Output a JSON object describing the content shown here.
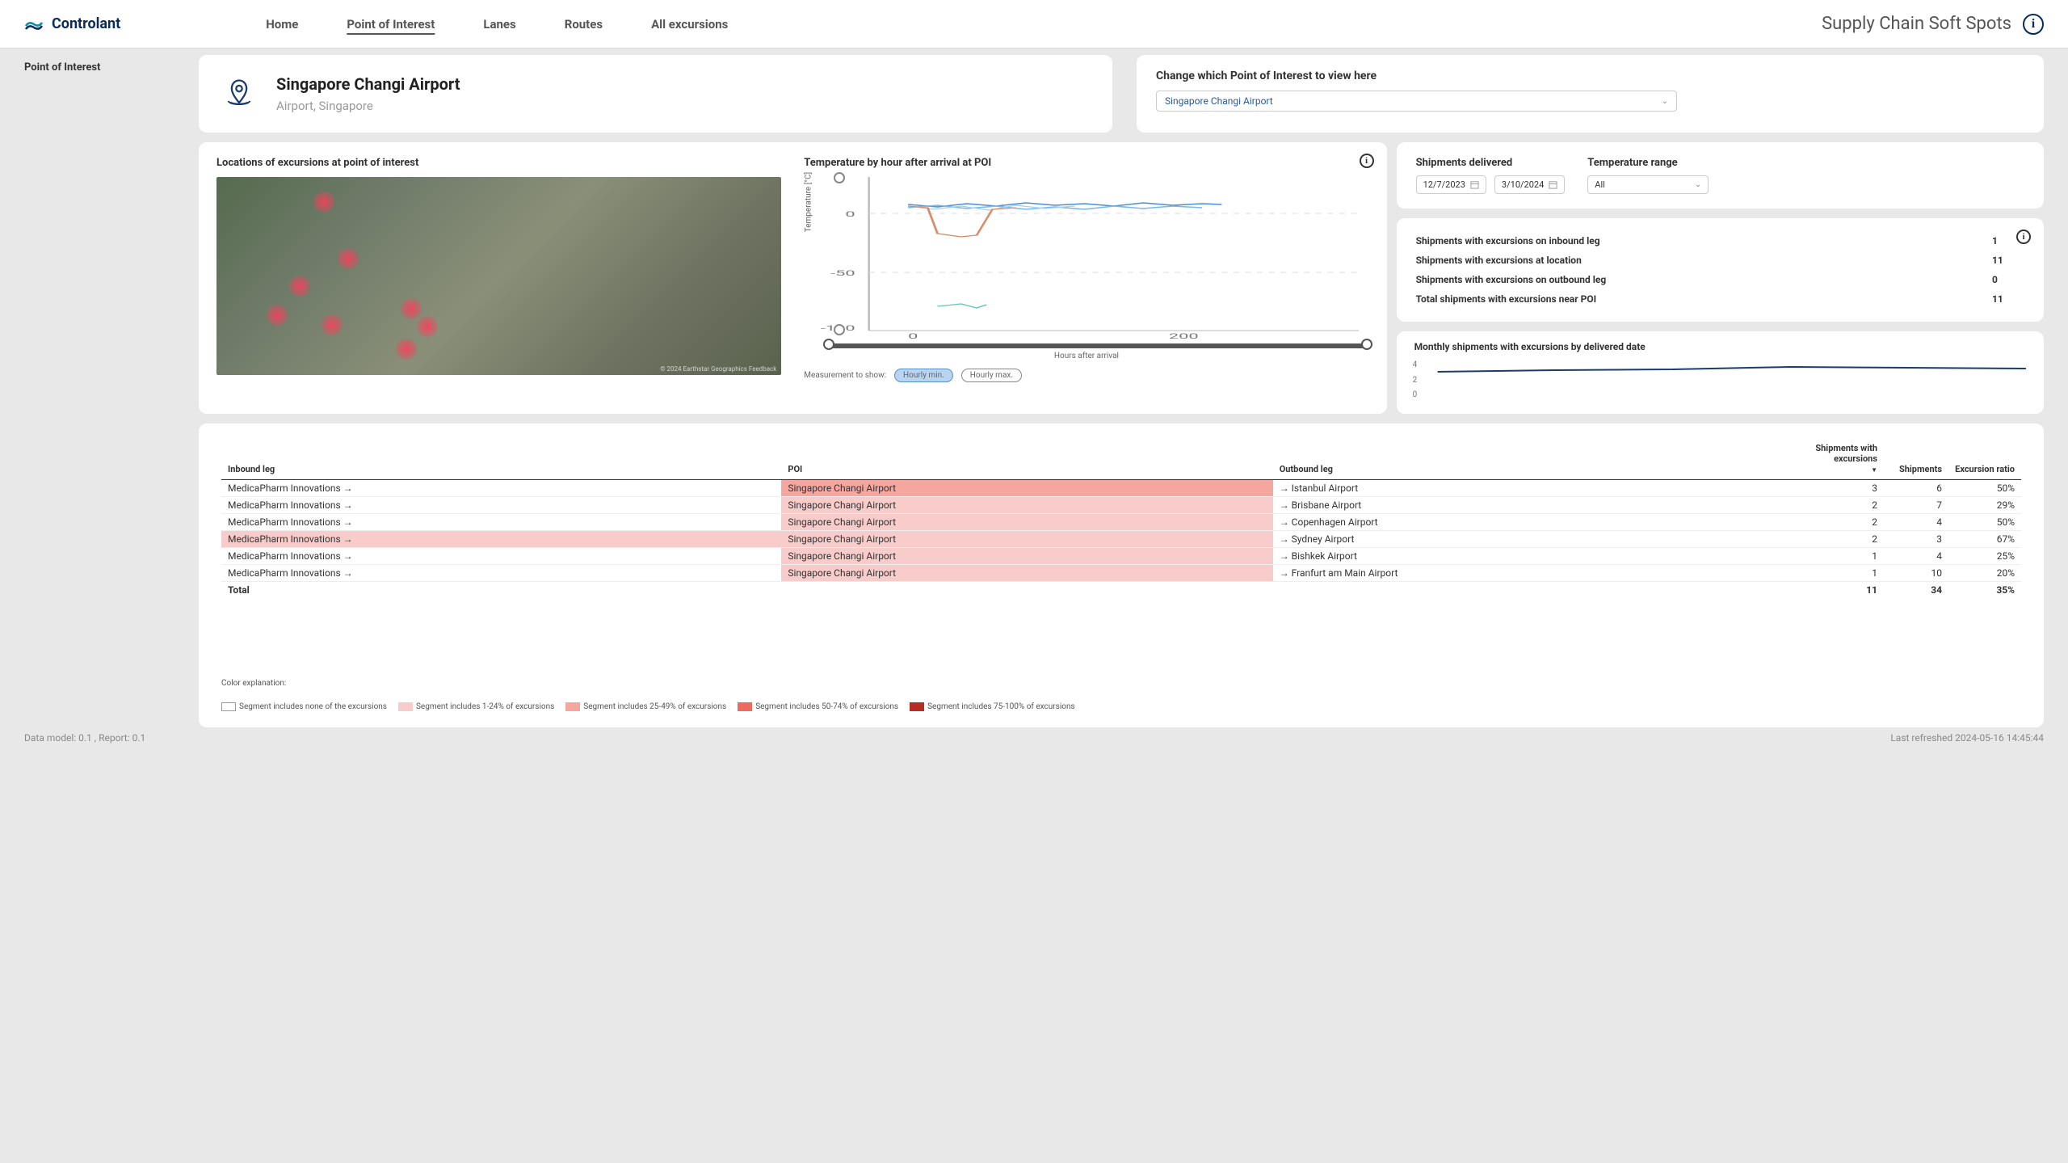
{
  "header": {
    "brand": "Controlant",
    "tabs": [
      "Home",
      "Point of Interest",
      "Lanes",
      "Routes",
      "All excursions"
    ],
    "active_tab": 1,
    "right_title": "Supply Chain Soft Spots"
  },
  "breadcrumb": "Point of Interest",
  "poi": {
    "name": "Singapore Changi Airport",
    "subtitle": "Airport, Singapore",
    "selector_label": "Change which Point of Interest to view here",
    "selector_value": "Singapore Changi Airport"
  },
  "map": {
    "title": "Locations of excursions at point of interest",
    "attribution": "© 2024 Earthstar Geographics  Feedback"
  },
  "temp_chart": {
    "title": "Temperature by hour after arrival at POI",
    "ylabel": "Temperature [°C]",
    "xlabel": "Hours after arrival",
    "measure_label": "Measurement to show:",
    "btn_min": "Hourly min.",
    "btn_max": "Hourly max."
  },
  "filters": {
    "shipments_label": "Shipments delivered",
    "temp_range_label": "Temperature range",
    "date_from": "12/7/2023",
    "date_to": "3/10/2024",
    "temp_range_value": "All"
  },
  "stats": {
    "rows": [
      {
        "label": "Shipments with excursions on inbound leg",
        "value": "1"
      },
      {
        "label": "Shipments with excursions at location",
        "value": "11"
      },
      {
        "label": "Shipments with excursions on outbound leg",
        "value": "0"
      },
      {
        "label": "Total shipments with excursions near POI",
        "value": "11"
      }
    ]
  },
  "monthly": {
    "title": "Monthly shipments with excursions by delivered date",
    "y_ticks": [
      "4",
      "2",
      "0"
    ]
  },
  "table": {
    "columns": [
      "Inbound leg",
      "POI",
      "Outbound leg",
      "Shipments with excursions",
      "Shipments",
      "Excursion ratio"
    ],
    "rows": [
      {
        "inbound": "MedicaPharm Innovations →",
        "in_hi": "none",
        "poi": "Singapore Changi Airport",
        "poi_hi": "50",
        "outbound": "→ Istanbul Airport",
        "out_hi": "none",
        "swe": "3",
        "ship": "6",
        "ratio": "50%"
      },
      {
        "inbound": "MedicaPharm Innovations →",
        "in_hi": "none",
        "poi": "Singapore Changi Airport",
        "poi_hi": "25",
        "outbound": "→ Brisbane Airport",
        "out_hi": "none",
        "swe": "2",
        "ship": "7",
        "ratio": "29%"
      },
      {
        "inbound": "MedicaPharm Innovations →",
        "in_hi": "none",
        "poi": "Singapore Changi Airport",
        "poi_hi": "25",
        "outbound": "→ Copenhagen Airport",
        "out_hi": "none",
        "swe": "2",
        "ship": "4",
        "ratio": "50%"
      },
      {
        "inbound": "MedicaPharm Innovations →",
        "in_hi": "25",
        "poi": "Singapore Changi Airport",
        "poi_hi": "25",
        "outbound": "→ Sydney Airport",
        "out_hi": "none",
        "swe": "2",
        "ship": "3",
        "ratio": "67%"
      },
      {
        "inbound": "MedicaPharm Innovations →",
        "in_hi": "none",
        "poi": "Singapore Changi Airport",
        "poi_hi": "25",
        "outbound": "→ Bishkek Airport",
        "out_hi": "none",
        "swe": "1",
        "ship": "4",
        "ratio": "25%"
      },
      {
        "inbound": "MedicaPharm Innovations →",
        "in_hi": "none",
        "poi": "Singapore Changi Airport",
        "poi_hi": "25",
        "outbound": "→ Franfurt am Main Airport",
        "out_hi": "none",
        "swe": "1",
        "ship": "10",
        "ratio": "20%"
      }
    ],
    "total": {
      "label": "Total",
      "swe": "11",
      "ship": "34",
      "ratio": "35%"
    }
  },
  "legend": {
    "intro": "Color explanation:",
    "items": [
      "Segment includes none of the excursions",
      "Segment includes 1-24% of excursions",
      "Segment includes 25-49% of excursions",
      "Segment includes 50-74% of excursions",
      "Segment includes 75-100% of excursions"
    ]
  },
  "footer": {
    "left": "Data model: 0.1 , Report: 0.1",
    "right": "Last refreshed 2024-05-16 14:45:44"
  },
  "chart_data": {
    "type": "line",
    "title": "Temperature by hour after arrival at POI",
    "xlabel": "Hours after arrival",
    "ylabel": "Temperature [°C]",
    "ylim": [
      -100,
      15
    ],
    "xlim": [
      0,
      300
    ],
    "y_ticks": [
      0,
      -50,
      -100
    ],
    "x_ticks": [
      0,
      200
    ],
    "series_note": "Multiple overlapping shipment traces; most cluster between 2°C and 8°C across 0–200h. One series dips to approx −20°C around 20–40h; one short trace near −70°C around 40–60h.",
    "monthly_chart": {
      "type": "line",
      "title": "Monthly shipments with excursions by delivered date",
      "ylim": [
        0,
        4
      ],
      "values_approx": [
        3,
        3.5,
        3.5,
        4,
        3.8
      ]
    }
  }
}
